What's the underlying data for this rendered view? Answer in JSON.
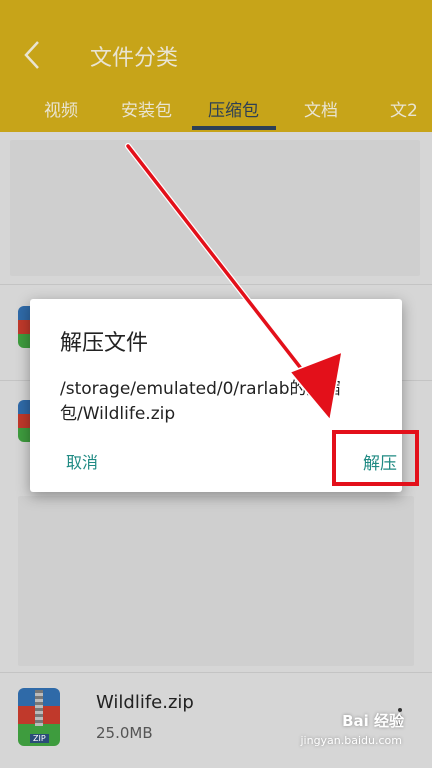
{
  "appbar": {
    "title": "文件分类",
    "back_icon": "back-arrow-icon"
  },
  "tabs": [
    {
      "label": "视频"
    },
    {
      "label": "安装包"
    },
    {
      "label": "压缩包",
      "active": true
    },
    {
      "label": "文档"
    },
    {
      "label": "文2"
    }
  ],
  "dialog": {
    "title": "解压文件",
    "message": "/storage/emulated/0/rarlab的压缩包/Wildlife.zip",
    "cancel_label": "取消",
    "extract_label": "解压"
  },
  "files": [
    {
      "name": "Wildlife.zip",
      "size": "25.0MB",
      "icon_tag": "ZIP"
    }
  ],
  "watermark": {
    "brand": "Bai 经验",
    "url": "jingyan.baidu.com"
  },
  "colors": {
    "appbar": "#c7a419",
    "accent": "#1f8a83",
    "highlight_box": "#e3101a",
    "arrow": "#e3101a"
  }
}
